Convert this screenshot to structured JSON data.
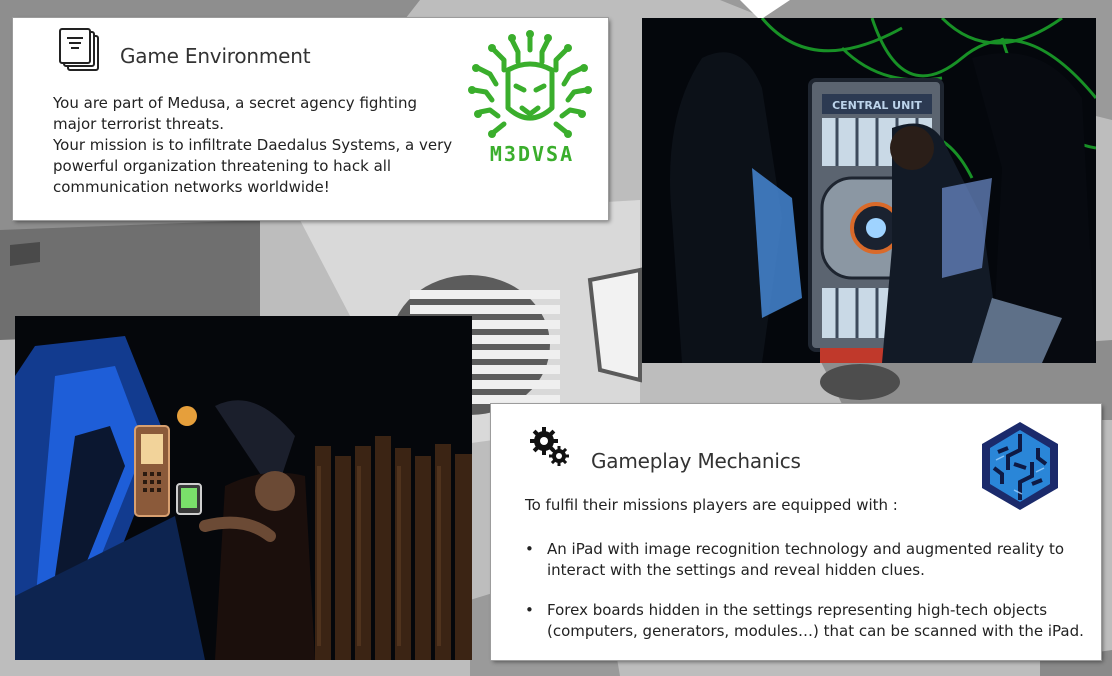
{
  "environment": {
    "title": "Game Environment",
    "icon": "document-icon",
    "paragraphs": [
      "You are part of Medusa, a secret agency fighting major terrorist threats.",
      "Your mission is to infiltrate Daedalus Systems, a very powerful organization threatening to hack all communication networks worldwide!"
    ],
    "logo_text": "M3DVSA"
  },
  "mechanics": {
    "title": "Gameplay Mechanics",
    "icon": "gears-icon",
    "intro": "To fulfil their missions players are equipped with :",
    "bullets": [
      "An iPad with image recognition technology and augmented reality to interact with the settings and reveal hidden clues.",
      "Forex boards hidden in the settings representing high-tech objects (computers, generators, modules…) that can be scanned with the iPad."
    ]
  },
  "photo_top": {
    "sign": "CENTRAL UNIT"
  },
  "colors": {
    "medusa_green": "#3aae2c",
    "daedalus_blue": "#1f6fb8",
    "daedalus_navy": "#1b2a6b",
    "card_text": "#222222"
  }
}
